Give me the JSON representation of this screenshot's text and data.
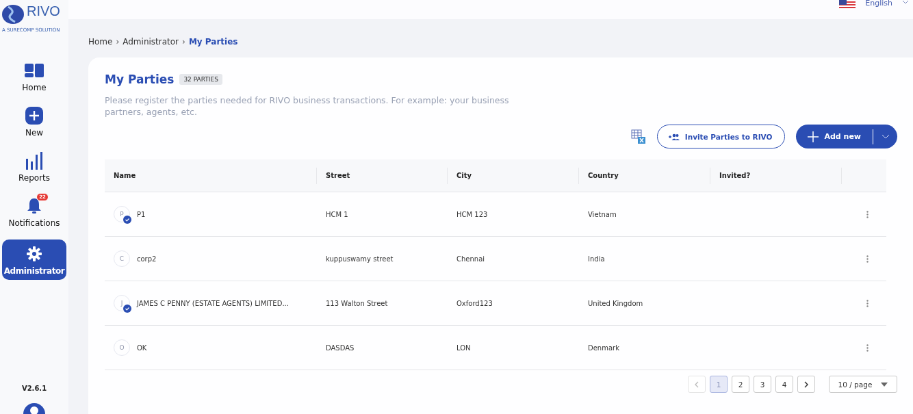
{
  "logo": {
    "name": "RIVO",
    "tagline": "A SURECOMP SOLUTION"
  },
  "language": {
    "label": "English"
  },
  "nav": [
    {
      "kind": "home",
      "label": "Home",
      "selected": false
    },
    {
      "kind": "new",
      "label": "New",
      "selected": false
    },
    {
      "kind": "reports",
      "label": "Reports",
      "selected": false
    },
    {
      "kind": "notifications",
      "label": "Notifications",
      "selected": false,
      "badge": "22"
    },
    {
      "kind": "admin",
      "label": "Administrator",
      "selected": true
    }
  ],
  "version": "V2.6.1",
  "breadcrumb_separator": "›",
  "breadcrumb": [
    {
      "label": "Home",
      "current": false
    },
    {
      "label": "Administrator",
      "current": false
    },
    {
      "label": "My Parties",
      "current": true
    }
  ],
  "page": {
    "title": "My Parties",
    "count": "32 PARTIES",
    "description": "Please register the parties needed for RIVO business transactions. For example: your business partners, agents, etc."
  },
  "actions": {
    "invite": "Invite Parties to RIVO",
    "add": "Add new"
  },
  "table": {
    "columns": [
      "Name",
      "Street",
      "City",
      "Country",
      "Invited?"
    ],
    "rows": [
      {
        "initial": "P",
        "verified": true,
        "name": "P1",
        "street": "HCM 1",
        "city": "HCM 123",
        "country": "Vietnam"
      },
      {
        "initial": "C",
        "verified": false,
        "name": "corp2",
        "street": "kuppuswamy street",
        "city": "Chennai",
        "country": "India"
      },
      {
        "initial": "J",
        "verified": true,
        "name": "JAMES C PENNY (ESTATE AGENTS) LIMITED...",
        "street": "113 Walton Street",
        "city": "Oxford123",
        "country": "United Kingdom"
      },
      {
        "initial": "O",
        "verified": false,
        "name": "OK",
        "street": "DASDAS",
        "city": "LON",
        "country": "Denmark"
      }
    ]
  },
  "pagination": {
    "pages": [
      {
        "label": "1",
        "selected": true
      },
      {
        "label": "2",
        "selected": false
      },
      {
        "label": "3",
        "selected": false
      },
      {
        "label": "4",
        "selected": false
      }
    ],
    "prev_disabled": true,
    "next_disabled": false,
    "page_size": "10 / page"
  }
}
